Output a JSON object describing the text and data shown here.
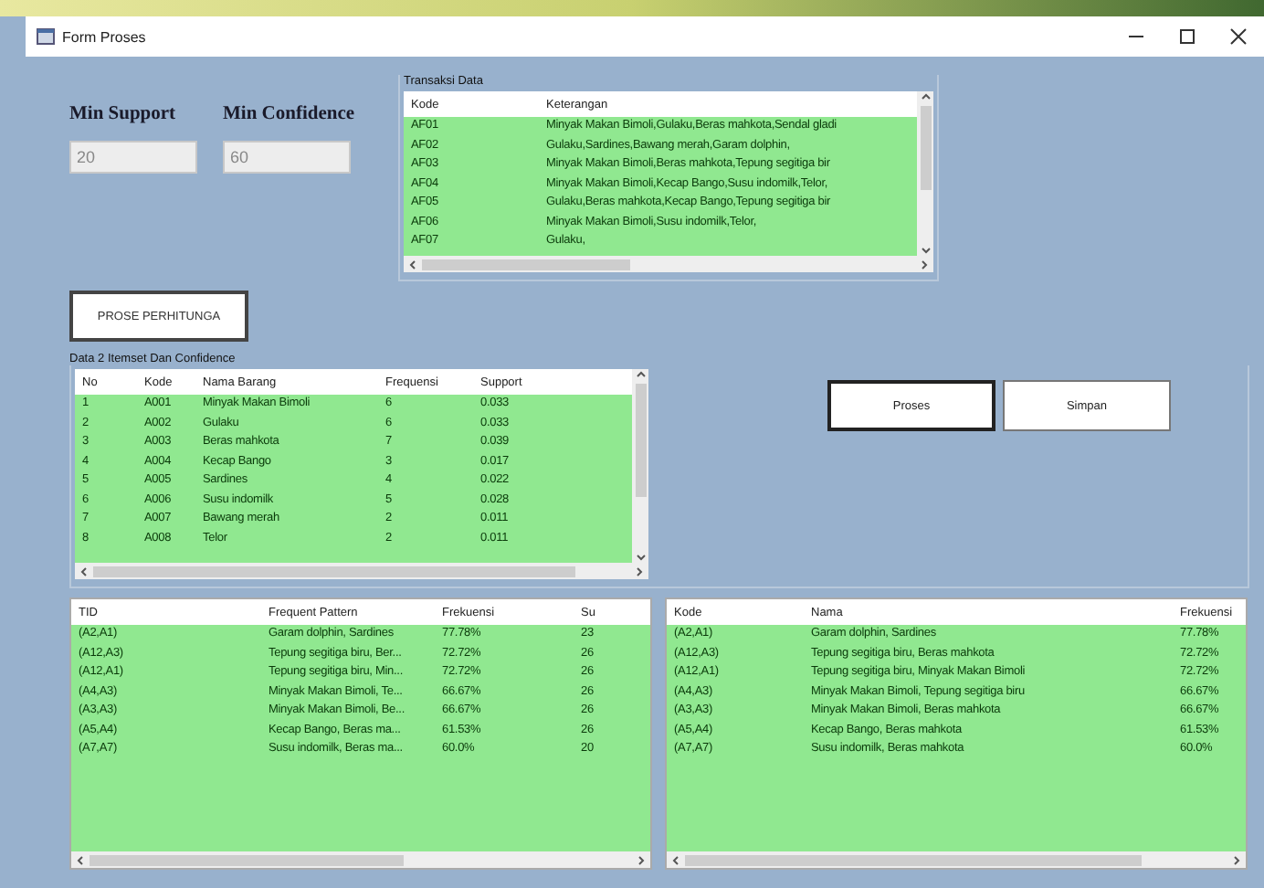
{
  "window": {
    "title": "Form Proses"
  },
  "min_support": {
    "label": "Min Support",
    "value": "20"
  },
  "min_confidence": {
    "label": "Min Confidence",
    "value": "60"
  },
  "transactions": {
    "title": "Transaksi Data",
    "columns": [
      "Kode",
      "Keterangan"
    ],
    "rows": [
      [
        "AF01",
        "Minyak Makan Bimoli,Gulaku,Beras mahkota,Sendal gladi"
      ],
      [
        "AF02",
        "Gulaku,Sardines,Bawang merah,Garam dolphin,"
      ],
      [
        "AF03",
        "Minyak Makan Bimoli,Beras mahkota,Tepung segitiga bir"
      ],
      [
        "AF04",
        "Minyak Makan Bimoli,Kecap Bango,Susu indomilk,Telor,"
      ],
      [
        "AF05",
        "Gulaku,Beras mahkota,Kecap Bango,Tepung segitiga bir"
      ],
      [
        "AF06",
        "Minyak Makan Bimoli,Susu indomilk,Telor,"
      ],
      [
        "AF07",
        "Gulaku,"
      ]
    ]
  },
  "process_button": "PROSE PERHITUNGA",
  "itemset": {
    "title": "Data 2 Itemset Dan Confidence",
    "columns": [
      "No",
      "Kode",
      "Nama Barang",
      "Frequensi",
      "Support"
    ],
    "rows": [
      [
        "1",
        "A001",
        "Minyak Makan Bimoli",
        "6",
        "0.033"
      ],
      [
        "2",
        "A002",
        "Gulaku",
        "6",
        "0.033"
      ],
      [
        "3",
        "A003",
        "Beras mahkota",
        "7",
        "0.039"
      ],
      [
        "4",
        "A004",
        "Kecap Bango",
        "3",
        "0.017"
      ],
      [
        "5",
        "A005",
        "Sardines",
        "4",
        "0.022"
      ],
      [
        "6",
        "A006",
        "Susu indomilk",
        "5",
        "0.028"
      ],
      [
        "7",
        "A007",
        "Bawang merah",
        "2",
        "0.011"
      ],
      [
        "8",
        "A008",
        "Telor",
        "2",
        "0.011"
      ]
    ]
  },
  "buttons": [
    {
      "label": "Proses",
      "selected": true
    },
    {
      "label": "Simpan",
      "selected": false
    }
  ],
  "patterns": {
    "columns": [
      "TID",
      "Frequent Pattern",
      "Frekuensi",
      "Su"
    ],
    "rows": [
      [
        "(A2,A1)",
        "Garam dolphin, Sardines",
        "77.78%",
        "23"
      ],
      [
        "(A12,A3)",
        "Tepung segitiga biru, Ber...",
        "72.72%",
        "26"
      ],
      [
        "(A12,A1)",
        "Tepung segitiga biru, Min...",
        "72.72%",
        "26"
      ],
      [
        "(A4,A3)",
        "Minyak Makan Bimoli, Te...",
        "66.67%",
        "26"
      ],
      [
        "(A3,A3)",
        "Minyak Makan Bimoli, Be...",
        "66.67%",
        "26"
      ],
      [
        "(A5,A4)",
        "Kecap Bango, Beras ma...",
        "61.53%",
        "26"
      ],
      [
        "(A7,A7)",
        "Susu indomilk, Beras ma...",
        "60.0%",
        "20"
      ]
    ]
  },
  "rules": {
    "columns": [
      "Kode",
      "Nama",
      "Frekuensi"
    ],
    "rows": [
      [
        "(A2,A1)",
        "Garam dolphin, Sardines",
        "77.78%"
      ],
      [
        "(A12,A3)",
        "Tepung segitiga biru, Beras mahkota",
        "72.72%"
      ],
      [
        "(A12,A1)",
        "Tepung segitiga biru, Minyak Makan Bimoli",
        "72.72%"
      ],
      [
        "(A4,A3)",
        "Minyak Makan Bimoli, Tepung segitiga biru",
        "66.67%"
      ],
      [
        "(A3,A3)",
        "Minyak Makan Bimoli, Beras mahkota",
        "66.67%"
      ],
      [
        "(A5,A4)",
        "Kecap Bango, Beras mahkota",
        "61.53%"
      ],
      [
        "(A7,A7)",
        "Susu indomilk, Beras mahkota",
        "60.0%"
      ]
    ]
  }
}
